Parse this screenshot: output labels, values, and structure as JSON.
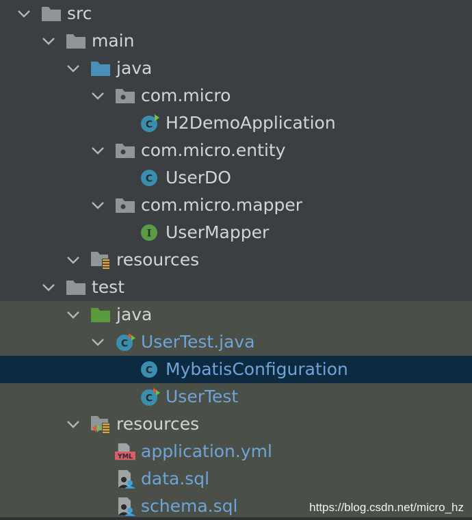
{
  "tree": [
    {
      "label": "src",
      "type": "folder",
      "depth": 0
    },
    {
      "label": "main",
      "type": "folder",
      "depth": 1
    },
    {
      "label": "java",
      "type": "source-folder",
      "depth": 2
    },
    {
      "label": "com.micro",
      "type": "package",
      "depth": 3
    },
    {
      "label": "H2DemoApplication",
      "type": "spring-class",
      "depth": 4
    },
    {
      "label": "com.micro.entity",
      "type": "package",
      "depth": 3
    },
    {
      "label": "UserDO",
      "type": "class",
      "depth": 4
    },
    {
      "label": "com.micro.mapper",
      "type": "package",
      "depth": 3
    },
    {
      "label": "UserMapper",
      "type": "interface",
      "depth": 4
    },
    {
      "label": "resources",
      "type": "resources-folder",
      "depth": 2
    },
    {
      "label": "test",
      "type": "folder",
      "depth": 1
    },
    {
      "label": "java",
      "type": "test-source-folder",
      "depth": 2
    },
    {
      "label": "UserTest.java",
      "type": "test-class-file",
      "depth": 3
    },
    {
      "label": "MybatisConfiguration",
      "type": "class",
      "depth": 4
    },
    {
      "label": "UserTest",
      "type": "test-class",
      "depth": 4
    },
    {
      "label": "resources",
      "type": "test-resources-folder",
      "depth": 2
    },
    {
      "label": "application.yml",
      "type": "yml-file",
      "depth": 3
    },
    {
      "label": "data.sql",
      "type": "sql-file",
      "depth": 3
    },
    {
      "label": "schema.sql",
      "type": "sql-file",
      "depth": 3
    }
  ],
  "watermark": "https://blog.csdn.net/micro_hz",
  "colors": {
    "background": "#3c3f41",
    "test_zone": "#4a4f47",
    "selected": "#0e2a40",
    "text": "#d2d4d6",
    "modified_text": "#6fa4d8"
  }
}
